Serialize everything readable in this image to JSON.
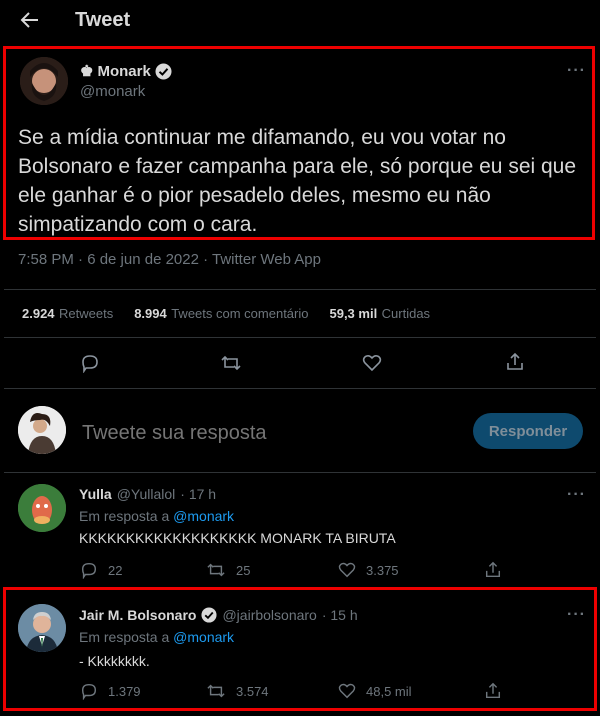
{
  "header": {
    "title": "Tweet"
  },
  "main_tweet": {
    "crown": "♚",
    "name": "Monark",
    "handle": "@monark",
    "text": "Se a mídia continuar me difamando, eu vou votar no Bolsonaro e fazer campanha para ele, só porque eu sei que ele ganhar é o pior pesadelo deles, mesmo eu não simpatizando com o cara.",
    "meta": "7:58 PM · 6 de jun de 2022 · Twitter Web App",
    "stats": [
      {
        "num": "2.924",
        "label": "Retweets"
      },
      {
        "num": "8.994",
        "label": "Tweets com comentário"
      },
      {
        "num": "59,3 mil",
        "label": "Curtidas"
      }
    ]
  },
  "compose": {
    "placeholder": "Tweete sua resposta",
    "button": "Responder"
  },
  "replies": [
    {
      "name": "Yulla",
      "handle": "@Yullalol",
      "time": "· 17 h",
      "reply_to_prefix": "Em resposta a",
      "reply_to": "@monark",
      "text": "KKKKKKKKKKKKKKKKKKK MONARK TA BIRUTA",
      "replies": "22",
      "retweets": "25",
      "likes": "3.375"
    },
    {
      "name": "Jair M. Bolsonaro",
      "handle": "@jairbolsonaro",
      "time": "· 15 h",
      "reply_to_prefix": "Em resposta a",
      "reply_to": "@monark",
      "text": "- Kkkkkkkk.",
      "replies": "1.379",
      "retweets": "3.574",
      "likes": "48,5 mil"
    }
  ],
  "colors": {
    "accent": "#1d9bf0",
    "highlight": "#e00000",
    "background": "#000000"
  },
  "icons": [
    "back-arrow-icon",
    "verified-icon",
    "more-icon",
    "reply-icon",
    "retweet-icon",
    "like-icon",
    "share-icon"
  ]
}
